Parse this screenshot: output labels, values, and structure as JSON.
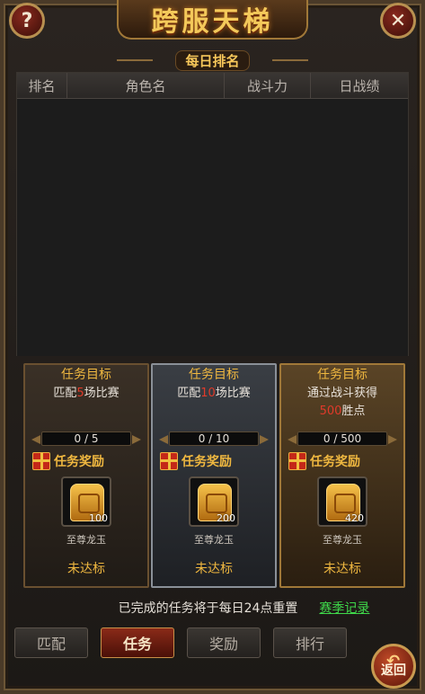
{
  "header": {
    "title": "跨服天梯",
    "subtitle": "每日排名",
    "help_label": "?",
    "close_label": "✕"
  },
  "ranking_table": {
    "columns": [
      "排名",
      "角色名",
      "战斗力",
      "日战绩"
    ],
    "rows": []
  },
  "tasks": [
    {
      "title": "任务目标",
      "desc_prefix": "匹配",
      "desc_highlight": "5",
      "desc_suffix": "场比赛",
      "progress": "0 / 5",
      "reward_label": "任务奖励",
      "item_name": "至尊龙玉",
      "item_count": "100",
      "status": "未达标",
      "style": "bronze"
    },
    {
      "title": "任务目标",
      "desc_prefix": "匹配",
      "desc_highlight": "10",
      "desc_suffix": "场比赛",
      "progress": "0 / 10",
      "reward_label": "任务奖励",
      "item_name": "至尊龙玉",
      "item_count": "200",
      "status": "未达标",
      "style": "silver"
    },
    {
      "title": "任务目标",
      "desc_prefix": "通过战斗获得",
      "desc_highlight": "500",
      "desc_suffix": "胜点",
      "progress": "0 / 500",
      "reward_label": "任务奖励",
      "item_name": "至尊龙玉",
      "item_count": "420",
      "status": "未达标",
      "style": "gold"
    }
  ],
  "footer": {
    "notice": "已完成的任务将于每日24点重置",
    "season_link": "赛季记录"
  },
  "tabs": [
    {
      "label": "匹配",
      "active": false
    },
    {
      "label": "任务",
      "active": true
    },
    {
      "label": "奖励",
      "active": false
    },
    {
      "label": "排行",
      "active": false
    }
  ],
  "back_button": {
    "label": "返回"
  },
  "colors": {
    "accent": "#f0b840",
    "highlight": "#e03a2a",
    "link": "#3fd84a"
  }
}
